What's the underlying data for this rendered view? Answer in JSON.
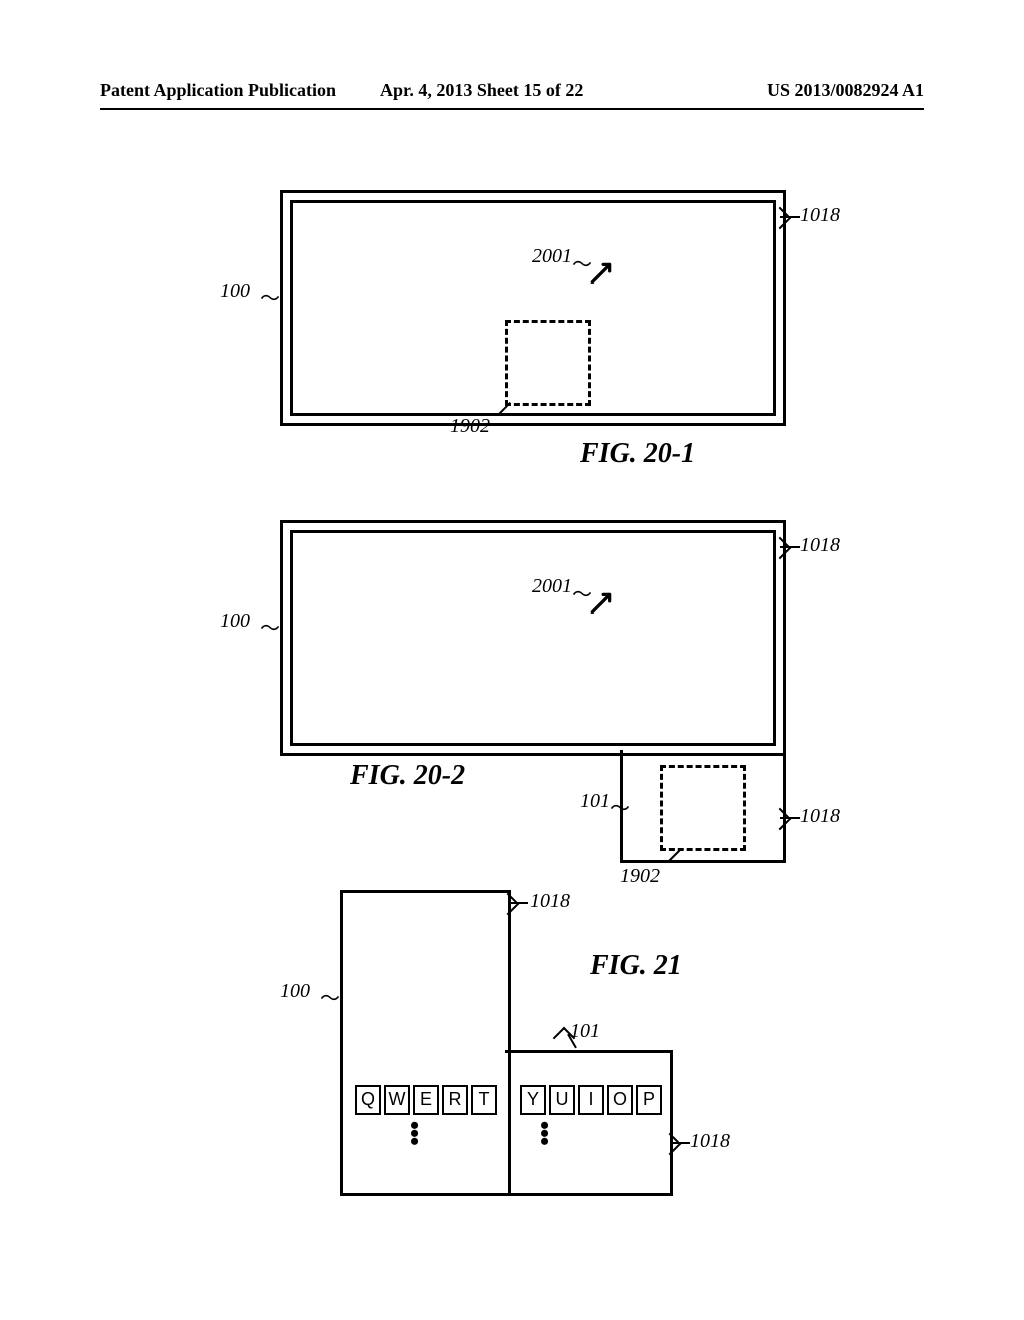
{
  "header": {
    "left": "Patent Application Publication",
    "mid": "Apr. 4, 2013  Sheet 15 of 22",
    "right": "US 2013/0082924 A1"
  },
  "fig201": {
    "caption": "FIG. 20-1",
    "ref100": "100",
    "ref1018": "1018",
    "ref2001": "2001",
    "ref1902": "1902"
  },
  "fig202": {
    "caption": "FIG. 20-2",
    "ref100": "100",
    "ref1018a": "1018",
    "ref2001": "2001",
    "ref101": "101",
    "ref1018b": "1018",
    "ref1902": "1902"
  },
  "fig21": {
    "caption": "FIG. 21",
    "ref100": "100",
    "ref1018a": "1018",
    "ref101": "101",
    "ref1018b": "1018",
    "keys_left": [
      "Q",
      "W",
      "E",
      "R",
      "T"
    ],
    "keys_right": [
      "Y",
      "U",
      "I",
      "O",
      "P"
    ]
  }
}
